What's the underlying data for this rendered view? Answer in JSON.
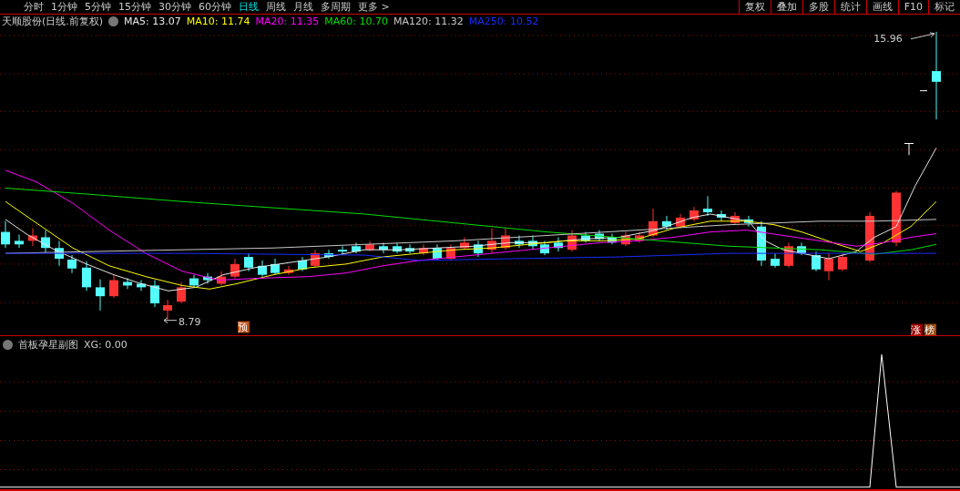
{
  "toolbar": {
    "periods": [
      {
        "label": "分时",
        "selected": false
      },
      {
        "label": "1分钟",
        "selected": false
      },
      {
        "label": "5分钟",
        "selected": false
      },
      {
        "label": "15分钟",
        "selected": false
      },
      {
        "label": "30分钟",
        "selected": false
      },
      {
        "label": "60分钟",
        "selected": false
      },
      {
        "label": "日线",
        "selected": true
      },
      {
        "label": "周线",
        "selected": false
      },
      {
        "label": "月线",
        "selected": false
      },
      {
        "label": "多周期",
        "selected": false
      },
      {
        "label": "更多 >",
        "selected": false
      }
    ],
    "tools": [
      "复权",
      "叠加",
      "多股",
      "统计",
      "画线",
      "F10",
      "标记"
    ]
  },
  "chart": {
    "title": "天顺股份(日线.前复权)",
    "ma": [
      {
        "label": "MA5: 13.07",
        "color": "#e8e8e8"
      },
      {
        "label": "MA10: 11.74",
        "color": "#ffff00"
      },
      {
        "label": "MA20: 11.35",
        "color": "#ff00ff"
      },
      {
        "label": "MA60: 10.70",
        "color": "#00e000"
      },
      {
        "label": "MA120: 11.32",
        "color": "#c8c8c8"
      },
      {
        "label": "MA250: 10.52",
        "color": "#1a2cff"
      }
    ],
    "low_label": "8.79",
    "high_label": "15.96",
    "markers": [
      {
        "label": "预",
        "color": "#b84a10"
      },
      {
        "label": "涨",
        "color": "#a00000"
      },
      {
        "label": "榜",
        "color": "#9a4a10"
      }
    ]
  },
  "indicator": {
    "title": "首板孕星副图",
    "reading": "XG: 0.00"
  }
}
